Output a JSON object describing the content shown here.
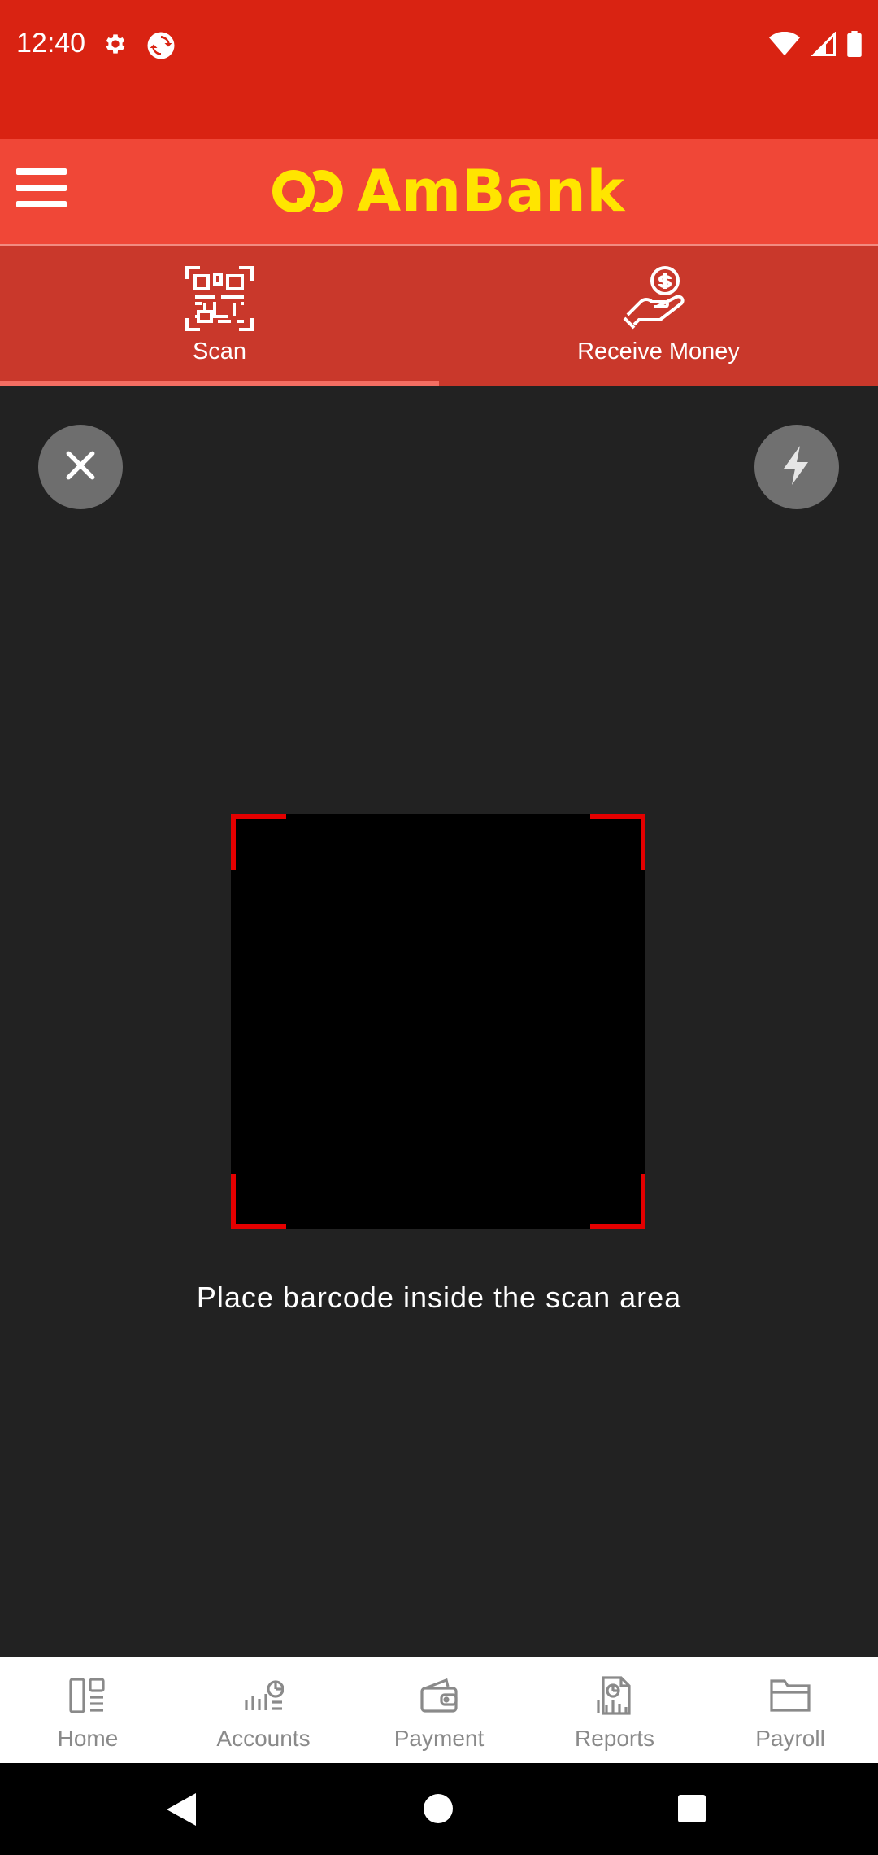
{
  "status_bar": {
    "time": "12:40",
    "icons_left": [
      "gear-icon",
      "sync-icon"
    ],
    "icons_right": [
      "wifi-icon",
      "signal-icon",
      "battery-icon"
    ]
  },
  "app_bar": {
    "brand": "AmBank",
    "menu_icon": "hamburger-menu-icon",
    "colors": {
      "header": "#f04737",
      "status": "#d92312",
      "logo": "#ffe500"
    }
  },
  "tabs": [
    {
      "label": "Scan",
      "icon": "qr-code-icon",
      "active": true
    },
    {
      "label": "Receive Money",
      "icon": "hand-coin-icon",
      "active": false
    }
  ],
  "scanner": {
    "close_icon": "close-icon",
    "flash_icon": "flash-icon",
    "hint": "Place barcode inside the scan area",
    "frame_color": "#e40000"
  },
  "bottom_nav": [
    {
      "label": "Home",
      "icon": "dashboard-icon"
    },
    {
      "label": "Accounts",
      "icon": "accounts-chart-icon"
    },
    {
      "label": "Payment",
      "icon": "wallet-icon"
    },
    {
      "label": "Reports",
      "icon": "report-icon"
    },
    {
      "label": "Payroll",
      "icon": "folder-icon"
    }
  ],
  "system_nav": [
    "back-icon",
    "home-icon",
    "recents-icon"
  ]
}
